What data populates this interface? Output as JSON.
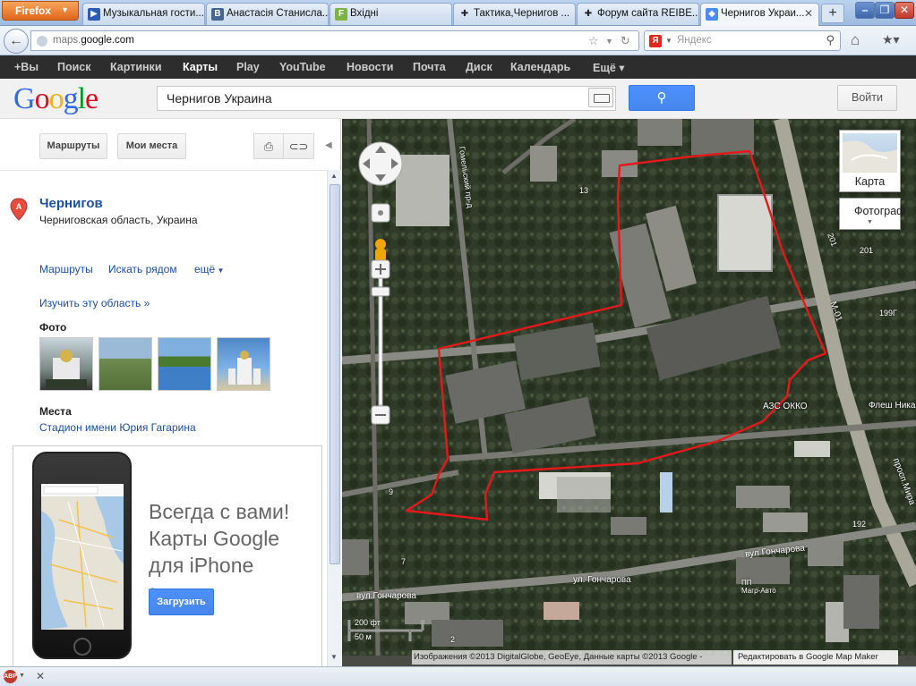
{
  "browser": {
    "menu_button": "Firefox",
    "tabs": [
      {
        "label": "Музыкальная гости...",
        "icon": "video-icon",
        "color": "#2a5db0"
      },
      {
        "label": "Анастасія Станисла...",
        "icon": "vk-icon",
        "color": "#45668e"
      },
      {
        "label": "Вхідні",
        "icon": "mail-icon",
        "color": "#7cb342"
      },
      {
        "label": "Тактика,Чернигов ...",
        "icon": "cross-icon",
        "color": "#222222"
      },
      {
        "label": "Форум сайта REIBE...",
        "icon": "cross-icon",
        "color": "#222222"
      },
      {
        "label": "Чернигов Украи...",
        "icon": "maps-icon",
        "color": "#4c8bf5"
      }
    ],
    "url_domain": "maps.",
    "url_host": "google.com",
    "search_placeholder": "Яндекс"
  },
  "google_bar": {
    "items": [
      "+Вы",
      "Поиск",
      "Картинки",
      "Карты",
      "Play",
      "YouTube",
      "Новости",
      "Почта",
      "Диск",
      "Календарь",
      "Ещё ▾"
    ],
    "selected": "Карты"
  },
  "header": {
    "logo_letters": [
      "G",
      "o",
      "o",
      "g",
      "l",
      "e"
    ],
    "query": "Чернигов Украина",
    "login": "Войти"
  },
  "panel": {
    "routes_button": "Маршруты",
    "my_places_button": "Мои места",
    "place_marker": "A",
    "place_name": "Чернигов",
    "place_address": "Черниговская область, Украина",
    "link_routes": "Маршруты",
    "link_nearby": "Искать рядом",
    "link_more": "ещё",
    "link_explore": "Изучить эту область »",
    "photos_heading": "Фото",
    "places_heading": "Места",
    "place_link": "Стадион имени Юрия Гагарина",
    "promo_line1": "Всегда с вами!",
    "promo_line2": "Карты Google",
    "promo_line3": "для iPhone",
    "promo_reg": "®.",
    "promo_button": "Загрузить"
  },
  "map": {
    "type_map": "Карта",
    "type_satellite": "Фотограф",
    "labels": {
      "street_gonchar_left": "вул.Гончарова",
      "street_gonchar_mid": "ул. Гончарова",
      "street_gonchar_right": "вул Гончарова",
      "azs": "АЗС ОККО",
      "flesh": "Флеш Ника",
      "m01": "М-01",
      "prosp": "просп.Мира",
      "n201": "201",
      "n201b": "201",
      "n199": "199Г",
      "n192": "192",
      "magr": "Магр-Авто",
      "pp": "ПП",
      "gomel": "Гомельский пр-д",
      "n13": "13",
      "n9": "9",
      "n7": "7",
      "n2": "2"
    },
    "scale_ft": "200 фт",
    "scale_m": "50 м",
    "copyright": "Изображения ©2013 DigitalGlobe, GeoEye, Данные карты ©2013 Google -",
    "mapmaker": "Редактировать в Google Map Maker",
    "route_color": "#e3191b"
  }
}
